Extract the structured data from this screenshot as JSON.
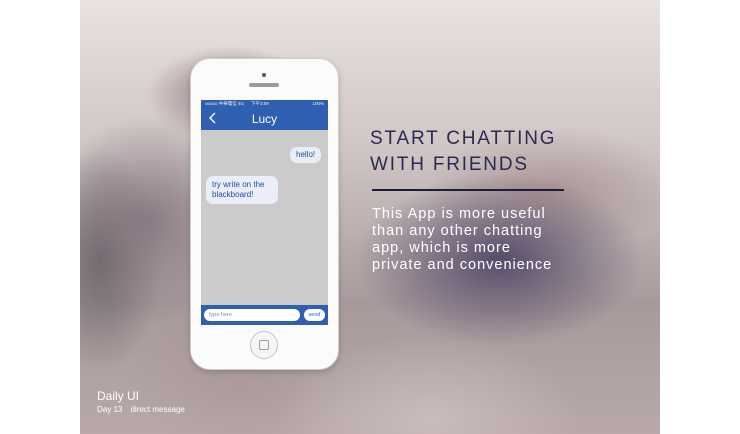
{
  "phone": {
    "status": {
      "carrier": "ooooo 中華電信 4G",
      "time": "下午3:09",
      "battery": "100%"
    },
    "chat": {
      "title": "Lucy",
      "messages": [
        {
          "from": "me",
          "text": "hello!"
        },
        {
          "from": "Lucy",
          "text": "try write on the blackboard!"
        }
      ],
      "input_placeholder": "type here",
      "send_label": "send"
    }
  },
  "headline": {
    "line1": "START CHATTING",
    "line2": "WITH FRIENDS"
  },
  "description": [
    "This App is more useful",
    "than any other chatting",
    "app, which is more",
    "private and convenience"
  ],
  "footer": {
    "title": "Daily UI",
    "day": "Day 13",
    "topic": "direct message"
  },
  "colors": {
    "accent": "#2f5fb0",
    "headline": "#2a2a52"
  },
  "icons": {
    "back": "chevron-left-icon",
    "home": "home-button-icon"
  }
}
